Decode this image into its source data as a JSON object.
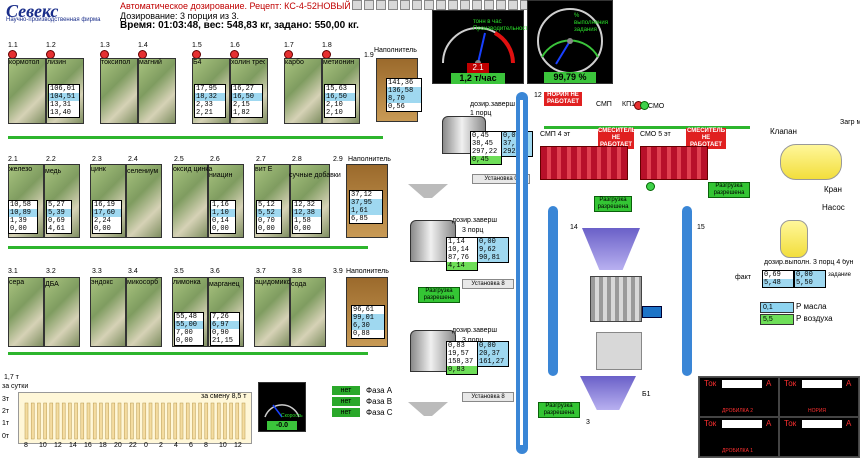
{
  "header": {
    "logo": "Севекс",
    "logo_sub": "Научно-производственная фирма",
    "title": "Автоматическое дозирование. Рецепт: КС-4-52НОВЫЙ",
    "dosing": "Дозирование:  3 порция из  3.",
    "time_line": "Время: 01:03:48,  вес: 548,83 кг,  задано: 550,00 кг."
  },
  "gauges": {
    "left": {
      "caption": "тонн в час Производительность",
      "red_value": "2.1",
      "value": "1,2 т/час"
    },
    "right": {
      "caption": "% выполнения задания",
      "value": "99,79 %"
    }
  },
  "row1": {
    "bins": [
      {
        "idx": "1.1",
        "name": "кормотол"
      },
      {
        "idx": "1.2",
        "name": "лизин"
      },
      {
        "idx": "1.3",
        "name": "токсипол"
      },
      {
        "idx": "1.4",
        "name": "магний"
      },
      {
        "idx": "1.5",
        "name": "Б4"
      },
      {
        "idx": "1.6",
        "name": "холин треонин"
      },
      {
        "idx": "1.7",
        "name": "карбо"
      },
      {
        "idx": "1.8",
        "name": "метионин"
      }
    ],
    "values": [
      [
        "106,01",
        "104,51",
        "13,31",
        "13,40"
      ],
      [
        "17,95",
        "18,32",
        "2,33",
        "2,21"
      ],
      [
        "16,27",
        "16,50",
        "2,15",
        "1,82"
      ],
      [
        "15,63",
        "16,50",
        "2,10",
        "2,10"
      ]
    ],
    "filler": {
      "idx": "1.9",
      "name": "Наполнитель",
      "values": [
        "141,36",
        "136,58",
        "8,70",
        "0,56"
      ]
    }
  },
  "row2": {
    "bins": [
      {
        "idx": "2.1",
        "name": "железо"
      },
      {
        "idx": "2.2",
        "name": "медь"
      },
      {
        "idx": "2.3",
        "name": "цинк"
      },
      {
        "idx": "2.4",
        "name": "селениум"
      },
      {
        "idx": "2.5",
        "name": "оксид цинка"
      },
      {
        "idx": "2.6",
        "name": "ниацин"
      },
      {
        "idx": "2.7",
        "name": "вит Е"
      },
      {
        "idx": "2.8",
        "name": "сучные добавки"
      }
    ],
    "values": [
      [
        "10,58",
        "10,89",
        "1,39",
        "0,00"
      ],
      [
        "5,27",
        "5,39",
        "0,69",
        "4,61"
      ],
      [
        "16,19",
        "17,60",
        "2,24",
        "0,00"
      ],
      [
        "1,16",
        "1,10",
        "0,14",
        "0,00"
      ],
      [
        "5,12",
        "5,52",
        "0,70",
        "0,00"
      ],
      [
        "12,32",
        "12,38",
        "1,58",
        "0,00"
      ]
    ],
    "filler": {
      "idx": "2.9",
      "name": "Наполнитель",
      "values": [
        "37,12",
        "37,95",
        "1,61",
        "6,85"
      ]
    }
  },
  "row3": {
    "bins": [
      {
        "idx": "3.1",
        "name": "сера"
      },
      {
        "idx": "3.2",
        "name": "ДБА"
      },
      {
        "idx": "3.3",
        "name": "эндокс"
      },
      {
        "idx": "3.4",
        "name": "микосорб"
      },
      {
        "idx": "3.5",
        "name": "лимонка"
      },
      {
        "idx": "3.6",
        "name": "марганец"
      },
      {
        "idx": "3.7",
        "name": "ацидомикс"
      },
      {
        "idx": "3.8",
        "name": "сода"
      }
    ],
    "values": [
      [
        "55,48",
        "55,00",
        "7,00",
        "0,00"
      ],
      [
        "7,26",
        "6,97",
        "0,90",
        "21,15"
      ]
    ],
    "filler": {
      "idx": "3.9",
      "name": "Наполнитель",
      "values": [
        "96,61",
        "99,01",
        "6,30",
        "0,88"
      ]
    }
  },
  "scales": {
    "s1": {
      "title": "дозир.заверш",
      "sub": "1 порц",
      "a": [
        "0,45",
        "38,45",
        "297,22",
        "0,45"
      ],
      "b": [
        "0,00",
        "37,24",
        "292,41"
      ],
      "installation": "Установка 0"
    },
    "s2": {
      "title": "дозир.заверш",
      "sub": "3 порц",
      "a": [
        "1,14",
        "10,14",
        "87,76",
        "4,14"
      ],
      "b": [
        "0,00",
        "9,62",
        "90,81"
      ],
      "installation": "Установка 8"
    },
    "s3": {
      "title": "дозир.заверш",
      "sub": "3 порц",
      "a": [
        "0,83",
        "19,57",
        "158,37",
        "0,83"
      ],
      "b": [
        "0,00",
        "20,37",
        "161,27"
      ],
      "installation": "Установка 8"
    }
  },
  "buttons": {
    "unload_allow": "Разгрузка разрешена"
  },
  "mixers": {
    "no_work": "НОРИЯ НЕ РАБОТАЕТ",
    "smp": "СМП",
    "kp": "КП1",
    "smo": "СМО",
    "smp4": "СМП 4 эт",
    "smo5": "СМО 5 эт",
    "mixer_not_work": "СМЕСИТЕЛЬ НЕ РАБОТАЕТ",
    "pos": {
      "a": "12",
      "b": "14",
      "c": "15",
      "d": "Б1",
      "e": "3"
    }
  },
  "liquids": {
    "klapan": "Клапан",
    "zagr": "Загр масла",
    "kran": "Кран",
    "nasos": "Насос",
    "title": "дозир.выполн. 3 порц 4 бун",
    "fact": "факт",
    "zadanie": "задание",
    "vals_left": [
      "0,69",
      "5,48"
    ],
    "vals_right": [
      "0,00",
      "5,50"
    ],
    "maslo_val": "0,1",
    "maslo": "Р масла",
    "vozduh_val": "5,5",
    "vozduh": "Р воздуха"
  },
  "phases": [
    {
      "status": "нет",
      "name": "Фаза A"
    },
    {
      "status": "нет",
      "name": "Фаза B"
    },
    {
      "status": "нет",
      "name": "Фаза C"
    }
  ],
  "small_gauge": {
    "caption": "Скорость",
    "value": "-0.0"
  },
  "day_chart": {
    "top_left": "1,7 т",
    "caption": "за сутки",
    "shift": "за смену 8,5 т",
    "y_labels": [
      "3т",
      "2т",
      "1т",
      "0т"
    ],
    "x_labels": [
      "8",
      "10",
      "12",
      "14",
      "16",
      "18",
      "20",
      "22",
      "0",
      "2",
      "4",
      "6",
      "8",
      "10",
      "12"
    ]
  },
  "meters": [
    {
      "label": "Ток",
      "unit": "А",
      "name": "ДРОБИЛКА 2"
    },
    {
      "label": "Ток",
      "unit": "А",
      "name": "НОРИЯ"
    },
    {
      "label": "Ток",
      "unit": "А",
      "name": "ДРОБИЛКА 1"
    },
    {
      "label": "Ток",
      "unit": "А",
      "name": ""
    }
  ]
}
